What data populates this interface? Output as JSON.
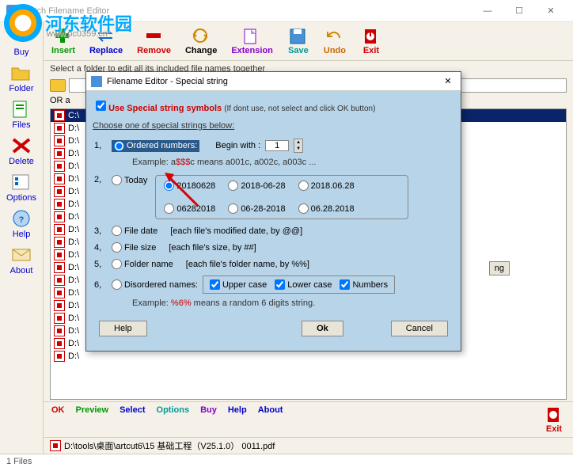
{
  "window": {
    "title": "Batch Filename Editor"
  },
  "watermark": {
    "text": "河东软件园",
    "url": "www.pc0359.cn"
  },
  "toolbar": {
    "buy": "Buy",
    "insert": "Insert",
    "replace": "Replace",
    "remove": "Remove",
    "change": "Change",
    "extension": "Extension",
    "save": "Save",
    "undo": "Undo",
    "exit": "Exit"
  },
  "sidebar": {
    "buy": "Buy",
    "folder": "Folder",
    "files": "Files",
    "delete": "Delete",
    "options": "Options",
    "help": "Help",
    "about": "About"
  },
  "hint": "Select a folder to edit all its included file names together",
  "or": "OR a",
  "selpath": "C:\\",
  "files": [
    "D:\\",
    "D:\\",
    "D:\\",
    "D:\\",
    "D:\\",
    "D:\\",
    "D:\\",
    "D:\\",
    "D:\\",
    "D:\\",
    "D:\\",
    "D:\\",
    "D:\\",
    "D:\\",
    "D:\\",
    "D:\\",
    "D:\\",
    "D:\\",
    "D:\\"
  ],
  "hiddenBtn": "ng",
  "bottom": {
    "ok": "OK",
    "preview": "Preview",
    "select": "Select",
    "options": "Options",
    "buy": "Buy",
    "help": "Help",
    "about": "About",
    "exit": "Exit"
  },
  "lastfile": "D:\\tools\\桌面\\artcut6\\15 基础工程（V25.1.0） 0011.pdf",
  "status": "1 Files",
  "dialog": {
    "title": "Filename Editor - Special string",
    "use": "Use Special string symbols",
    "usehint": "(If dont use, not select and click OK button)",
    "choose": "Choose one of special strings below:",
    "n1": "1,",
    "ordered": "Ordered numbers:",
    "begin": "Begin with :",
    "beginval": "1",
    "ex1a": "Example: a",
    "ex1b": "$$$",
    "ex1c": "c  means a001c, a002c, a003c ...",
    "n2": "2,",
    "today": "Today",
    "d1": "20180628",
    "d2": "2018-06-28",
    "d3": "2018.06.28",
    "d4": "06282018",
    "d5": "06-28-2018",
    "d6": "06.28.2018",
    "n3": "3,",
    "filedate": "File date",
    "filedatehint": "[each file's modified date, by ",
    "filedatesym": "@@",
    "brk": "]",
    "n4": "4,",
    "filesize": "File size",
    "filesizehint": "[each file's size, by  ",
    "filesizesym": "##",
    "n5": "5,",
    "foldername": "Folder name",
    "foldernamehint": "[each file's folder name, by  ",
    "foldernamesym": "%%",
    "n6": "6,",
    "disordered": "Disordered names:",
    "upper": "Upper case",
    "lower": "Lower case",
    "numbers": "Numbers",
    "ex6a": "Example: ",
    "ex6b": "%6%",
    "ex6c": "  means a random 6 digits string.",
    "help": "Help",
    "ok": "Ok",
    "cancel": "Cancel"
  }
}
